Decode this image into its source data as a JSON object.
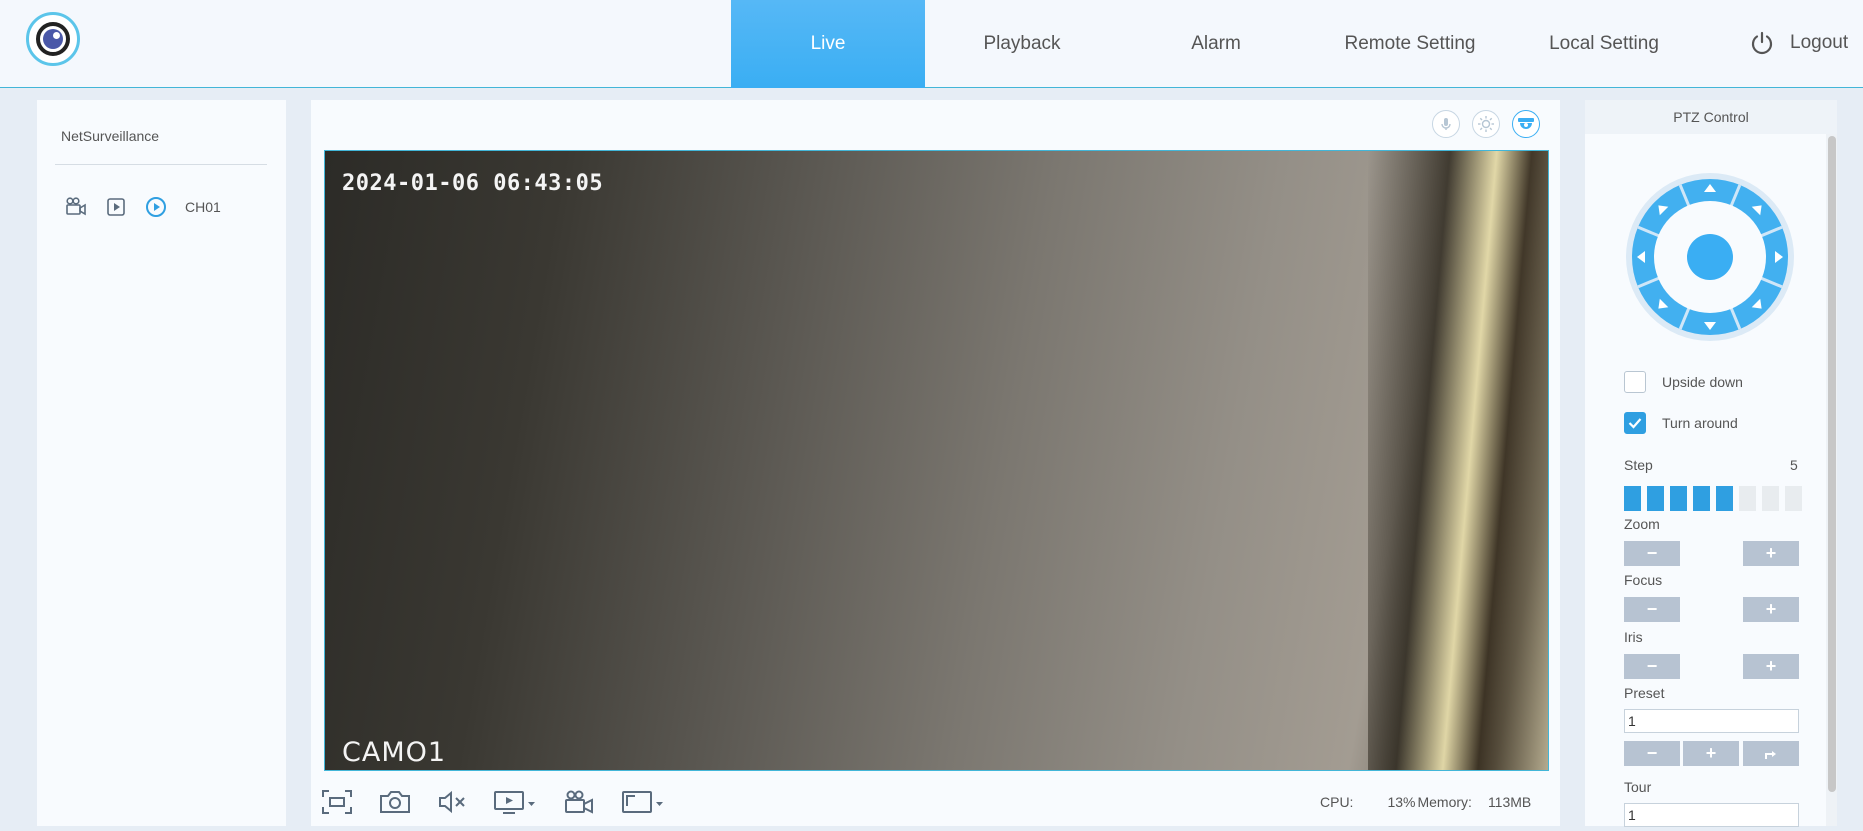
{
  "header": {
    "nav": [
      "Live",
      "Playback",
      "Alarm",
      "Remote Setting",
      "Local Setting"
    ],
    "active_tab": "Live",
    "logout_label": "Logout",
    "accent_color": "#3aaef3"
  },
  "left_panel": {
    "title": "NetSurveillance",
    "channel_label": "CH01"
  },
  "video": {
    "timestamp": "2024-01-06 06:43:05",
    "camera_name": "CAMO1"
  },
  "stats": {
    "cpu_label": "CPU:",
    "cpu_value": "13%",
    "memory_label": "Memory:",
    "memory_value": "113MB"
  },
  "ptz": {
    "title": "PTZ Control",
    "upside_down_label": "Upside down",
    "upside_down_checked": false,
    "turn_around_label": "Turn around",
    "turn_around_checked": true,
    "step_label": "Step",
    "step_value": "5",
    "step_max": 8,
    "zoom_label": "Zoom",
    "focus_label": "Focus",
    "iris_label": "Iris",
    "preset_label": "Preset",
    "preset_value": "1",
    "tour_label": "Tour",
    "tour_value": "1",
    "minus": "−",
    "plus": "+"
  }
}
